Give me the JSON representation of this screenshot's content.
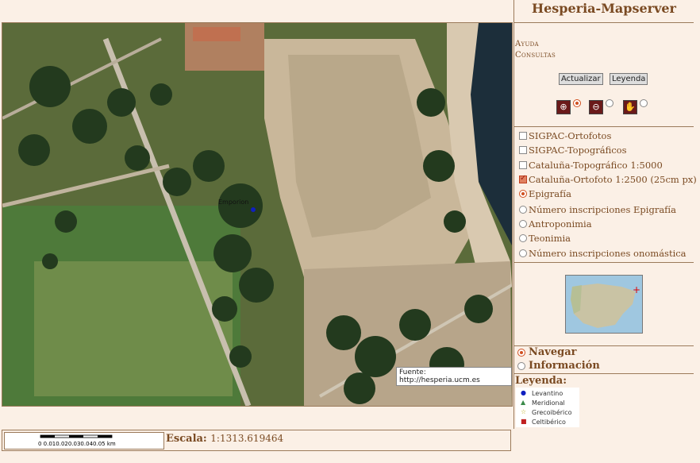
{
  "app": {
    "title": "Hesperia-Mapserver"
  },
  "links": {
    "help": "Ayuda",
    "queries": "Consultas"
  },
  "buttons": {
    "refresh": "Actualizar",
    "legend": "Leyenda"
  },
  "tools": [
    {
      "name": "zoom-in",
      "glyph": "⊕",
      "selected": true
    },
    {
      "name": "zoom-out",
      "glyph": "⊖",
      "selected": false
    },
    {
      "name": "pan",
      "glyph": "✋",
      "selected": false
    }
  ],
  "layers": [
    {
      "label": "SIGPAC-Ortofotos",
      "type": "checkbox",
      "checked": false
    },
    {
      "label": "SIGPAC-Topográficos",
      "type": "checkbox",
      "checked": false
    },
    {
      "label": "Cataluña-Topográfico 1:5000",
      "type": "checkbox",
      "checked": false
    },
    {
      "label": "Cataluña-Ortofoto 1:2500 (25cm px)",
      "type": "checkbox",
      "checked": true
    },
    {
      "label": "Epigrafía",
      "type": "radio",
      "checked": true
    },
    {
      "label": "Número inscripciones Epigrafía",
      "type": "radio",
      "checked": false
    },
    {
      "label": "Antroponimia",
      "type": "radio",
      "checked": false
    },
    {
      "label": "Teonimia",
      "type": "radio",
      "checked": false
    },
    {
      "label": "Número inscripciones onomástica",
      "type": "radio",
      "checked": false
    }
  ],
  "modes": [
    {
      "label": "Navegar",
      "selected": true
    },
    {
      "label": "Información",
      "selected": false
    }
  ],
  "legend": {
    "title": "Leyenda:",
    "items": [
      {
        "label": "Levantino",
        "color": "#1020c0",
        "symbol": "●"
      },
      {
        "label": "Meridional",
        "color": "#3a8a4a",
        "symbol": "▲"
      },
      {
        "label": "Grecoibérico",
        "color": "#c0b020",
        "symbol": "☆"
      },
      {
        "label": "Celtibérico",
        "color": "#c02020",
        "symbol": "■"
      }
    ]
  },
  "map": {
    "source": "Fuente: http://hesperia.ucm.es",
    "marker_label": "Emporion"
  },
  "scale": {
    "label": "Escala:",
    "value": "1:1313.619464",
    "bar_text": "0  0.010.020.030.040.05  km"
  }
}
